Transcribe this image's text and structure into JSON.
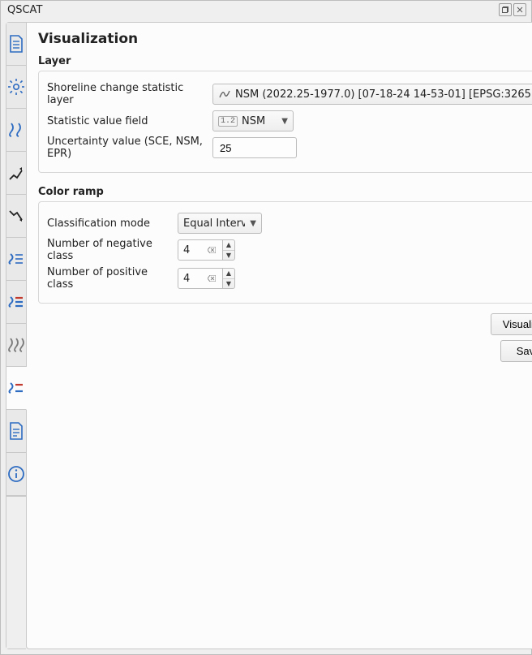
{
  "window": {
    "title": "QSCAT"
  },
  "page": {
    "title": "Visualization"
  },
  "layer_section": {
    "title": "Layer",
    "stat_layer_label": "Shoreline change statistic layer",
    "stat_layer_value": "NSM (2022.25-1977.0) [07-18-24 14-53-01] [EPSG:3265",
    "stat_field_label": "Statistic value field",
    "stat_field_prefix": "1.2",
    "stat_field_value": "NSM",
    "uncertainty_label": "Uncertainty value (SCE, NSM, EPR)",
    "uncertainty_value": "25"
  },
  "ramp_section": {
    "title": "Color ramp",
    "mode_label": "Classification mode",
    "mode_value": "Equal Interval",
    "neg_label": "Number of negative class",
    "neg_value": "4",
    "pos_label": "Number of positive class",
    "pos_value": "4"
  },
  "buttons": {
    "visualize": "Visualize",
    "save": "Save"
  }
}
